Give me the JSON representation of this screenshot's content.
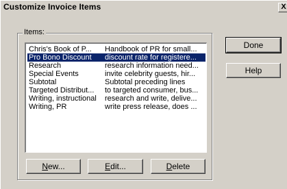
{
  "dialog": {
    "title": "Customize Invoice Items",
    "close_label": "X"
  },
  "items_group": {
    "label": "Items:"
  },
  "items": [
    {
      "name": "Chris's Book of P...",
      "description": "Handbook of PR for small...",
      "selected": false
    },
    {
      "name": "Pro Bono Discount",
      "description": "discount rate for registere...",
      "selected": true
    },
    {
      "name": "Research",
      "description": "research information need...",
      "selected": false
    },
    {
      "name": "Special Events",
      "description": "invite celebrity guests, hir...",
      "selected": false
    },
    {
      "name": "Subtotal",
      "description": "Subtotal preceding lines",
      "selected": false
    },
    {
      "name": "Targeted Distribut...",
      "description": "to targeted consumer, bus...",
      "selected": false
    },
    {
      "name": "Writing, instructional",
      "description": "research and write, delive...",
      "selected": false
    },
    {
      "name": "Writing, PR",
      "description": "write press release, does ...",
      "selected": false
    }
  ],
  "buttons": {
    "new_label_key": "N",
    "new_label_rest": "ew...",
    "edit_label_key": "E",
    "edit_label_rest": "dit...",
    "delete_label_key": "D",
    "delete_label_rest": "elete",
    "done_label": "Done",
    "help_label": "Help"
  }
}
